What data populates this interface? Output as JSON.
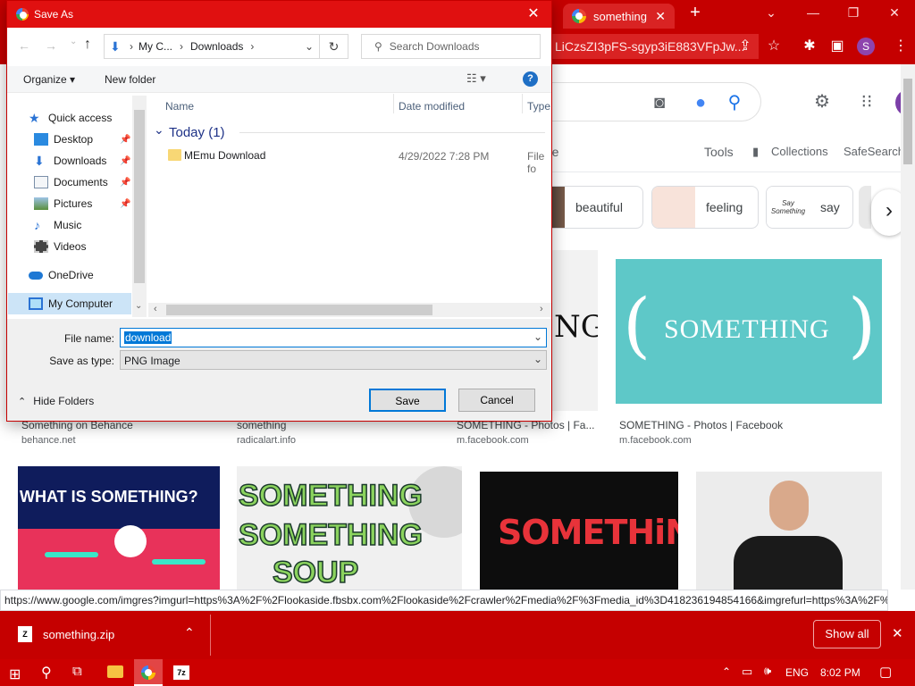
{
  "browser": {
    "tab_title": "something",
    "omnibox_text": "LiCzsZI3pFS-sgyp3iE883VFpJw...",
    "status_url": "https://www.google.com/imgres?imgurl=https%3A%2F%2Flookaside.fbsbx.com%2Flookaside%2Fcrawler%2Fmedia%2F%3Fmedia_id%3D418236194854166&imgrefurl=https%3A%2F%...",
    "profile_initial": "S"
  },
  "google": {
    "tools": "Tools",
    "collections": "Collections",
    "safesearch": "SafeSearch",
    "partial_text": "re",
    "chips": [
      {
        "label": "beautiful"
      },
      {
        "label": "feeling"
      },
      {
        "label": "say"
      }
    ],
    "chip_thumb_text": "Say Something",
    "results": [
      {
        "caption": "Something on Behance",
        "source": "behance.net"
      },
      {
        "caption": "something",
        "source": "radicalart.info"
      },
      {
        "caption": "SOMETHING - Photos | Fa...",
        "source": "m.facebook.com"
      },
      {
        "caption": "SOMETHING - Photos | Facebook",
        "source": "m.facebook.com"
      }
    ],
    "image_texts": {
      "teal": "SOMETHING",
      "partial": "NG.",
      "what_is": "WHAT IS SOMETHING?",
      "soup1": "SOMETHING",
      "soup2": "SOMETHING",
      "soup3": "SOUP",
      "red": "SOMETHiNG"
    }
  },
  "downloads": {
    "file": "something.zip",
    "show_all": "Show all"
  },
  "taskbar": {
    "lang": "ENG",
    "time": "8:02 PM"
  },
  "dialog": {
    "title": "Save As",
    "breadcrumb": [
      "My C...",
      "Downloads"
    ],
    "search_placeholder": "Search Downloads",
    "organize": "Organize",
    "new_folder": "New folder",
    "nav": [
      {
        "label": "Quick access",
        "name": "nav-quick-access"
      },
      {
        "label": "Desktop",
        "name": "nav-desktop"
      },
      {
        "label": "Downloads",
        "name": "nav-downloads"
      },
      {
        "label": "Documents",
        "name": "nav-documents"
      },
      {
        "label": "Pictures",
        "name": "nav-pictures"
      },
      {
        "label": "Music",
        "name": "nav-music"
      },
      {
        "label": "Videos",
        "name": "nav-videos"
      },
      {
        "label": "OneDrive",
        "name": "nav-onedrive"
      },
      {
        "label": "My Computer",
        "name": "nav-my-computer"
      }
    ],
    "columns": {
      "name": "Name",
      "date": "Date modified",
      "type": "Type"
    },
    "group": "Today (1)",
    "files": [
      {
        "name": "MEmu Download",
        "date": "4/29/2022 7:28 PM",
        "type": "File fo"
      }
    ],
    "file_name_label": "File name:",
    "file_name_value": "download",
    "save_type_label": "Save as type:",
    "save_type_value": "PNG Image",
    "hide_folders": "Hide Folders",
    "save": "Save",
    "cancel": "Cancel"
  },
  "colors": {
    "chrome_red": "#c50000",
    "teal": "#5ec8c8",
    "dialog_title": "#e01010"
  }
}
